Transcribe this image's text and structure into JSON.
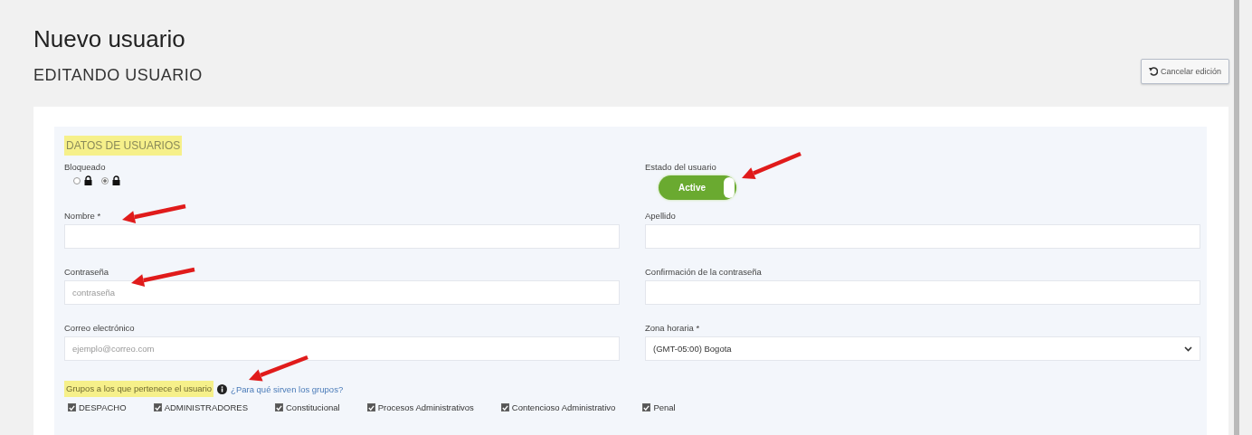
{
  "page": {
    "title": "Nuevo usuario",
    "subtitle": "EDITANDO USUARIO",
    "cancel_button": "Cancelar edición"
  },
  "section": {
    "title": "DATOS DE USUARIOS"
  },
  "blocked": {
    "label": "Bloqueado",
    "options": [
      {
        "selected": false
      },
      {
        "selected": true
      }
    ]
  },
  "status": {
    "label": "Estado del usuario",
    "toggle": {
      "label": "Active",
      "on": true
    }
  },
  "fields": [
    {
      "label": "Nombre *",
      "kind": "text"
    },
    {
      "label": "Apellido",
      "kind": "text"
    },
    {
      "label": "Contraseña",
      "placeholder": "contraseña",
      "kind": "text"
    },
    {
      "label": "Confirmación de la contraseña",
      "kind": "text"
    },
    {
      "label": "Correo electrónico",
      "placeholder": "ejemplo@correo.com",
      "kind": "text"
    },
    {
      "label": "Zona horaria *",
      "value": "(GMT-05:00) Bogota",
      "kind": "select"
    }
  ],
  "groups": {
    "label": "Grupos a los que pertenece el usuario",
    "help_link": "¿Para qué sirven los grupos?",
    "items": [
      {
        "label": "DESPACHO",
        "checked": true
      },
      {
        "label": "ADMINISTRADORES",
        "checked": true
      },
      {
        "label": "Constitucional",
        "checked": true
      },
      {
        "label": "Procesos Administrativos",
        "checked": true
      },
      {
        "label": "Contencioso Administrativo",
        "checked": true
      },
      {
        "label": "Penal",
        "checked": true
      }
    ]
  }
}
